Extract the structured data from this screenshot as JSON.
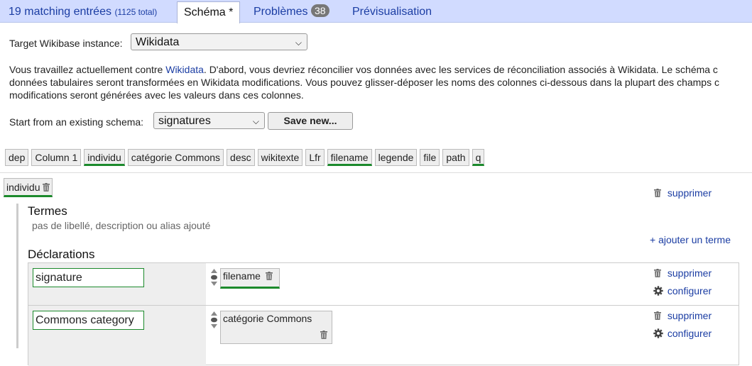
{
  "tabs": {
    "matching": "19 matching entrées",
    "matching_total": "(1125 total)",
    "schema": "Schéma *",
    "problems": "Problèmes",
    "problems_count": "38",
    "preview": "Prévisualisation"
  },
  "target": {
    "label": "Target Wikibase instance:",
    "value": "Wikidata"
  },
  "intro": {
    "line1_pre": "Vous travaillez actuellement contre ",
    "line1_link": "Wikidata",
    "line1_post": ". D'abord, vous devriez réconcilier vos données avec les services de réconciliation associés à Wikidata. Le schéma c",
    "line2": "données tabulaires seront transformées en Wikidata modifications. Vous pouvez glisser-déposer les noms des colonnes ci-dessous dans la plupart des champs c",
    "line3": "modifications seront générées avec les valeurs dans ces colonnes."
  },
  "schema_select": {
    "label": "Start from an existing schema:",
    "value": "signatures",
    "save_label": "Save new..."
  },
  "columns": [
    {
      "name": "dep",
      "used": false
    },
    {
      "name": "Column 1",
      "used": false
    },
    {
      "name": "individu",
      "used": true
    },
    {
      "name": "catégorie Commons",
      "used": false
    },
    {
      "name": "desc",
      "used": false
    },
    {
      "name": "wikitexte",
      "used": false
    },
    {
      "name": "Lfr",
      "used": false
    },
    {
      "name": "filename",
      "used": true
    },
    {
      "name": "legende",
      "used": false
    },
    {
      "name": "file",
      "used": false
    },
    {
      "name": "path",
      "used": false
    },
    {
      "name": "q",
      "used": true
    }
  ],
  "item": {
    "subject": "individu",
    "delete_label": "supprimer",
    "terms_heading": "Termes",
    "terms_empty": "pas de libellé, description ou alias ajouté",
    "add_term": "+ ajouter un terme",
    "statements_heading": "Déclarations"
  },
  "statements": [
    {
      "property": "signature",
      "value": "filename",
      "delete_label": "supprimer",
      "configure_label": "configurer"
    },
    {
      "property": "Commons category",
      "value": "catégorie Commons",
      "delete_label": "supprimer",
      "configure_label": "configurer"
    }
  ],
  "colors": {
    "accent": "#1b3da3",
    "used_marker": "#1c8a2c",
    "topbar": "#d1dbff"
  }
}
